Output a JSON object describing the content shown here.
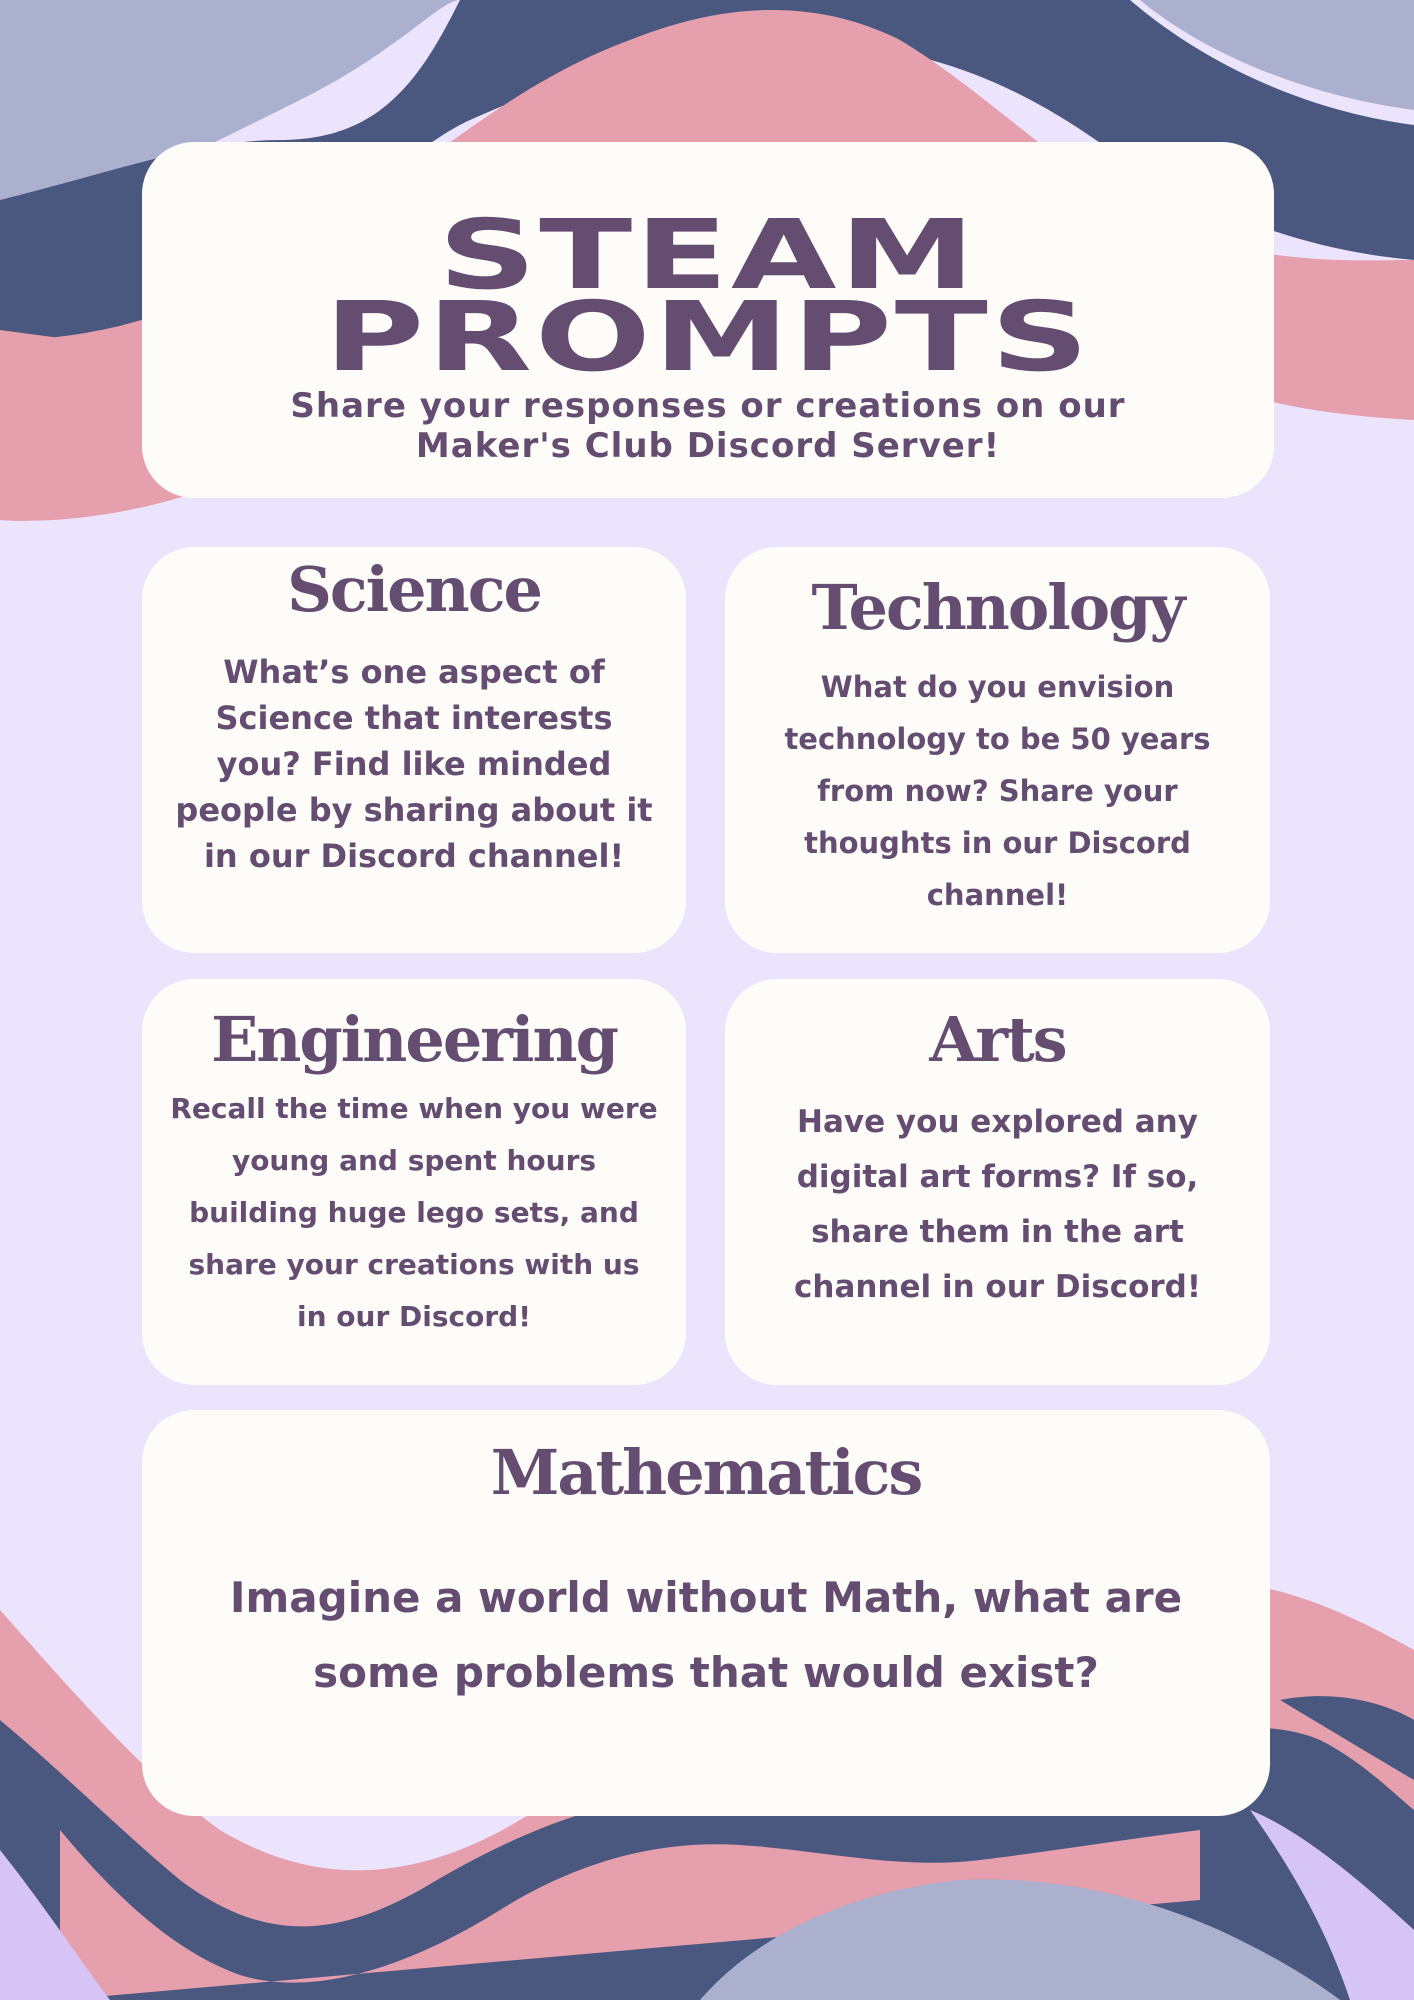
{
  "colors": {
    "background": "#ece3fd",
    "card": "#fdfcf8",
    "text": "#654d72",
    "wave_navy": "#4a5880",
    "wave_pink": "#e59fad",
    "wave_gray": "#aab0cd",
    "wave_lilac": "#d6c4f7"
  },
  "header": {
    "title_line1": "STEAM",
    "title_line2": "PROMPTS",
    "subtitle": "Share your responses or creations on our\nMaker's Club Discord Server!"
  },
  "cards": {
    "science": {
      "heading": "Science",
      "body": "What’s one aspect of Science that interests you? Find like minded people by sharing about it in our Discord channel!"
    },
    "technology": {
      "heading": "Technology",
      "body": "What do you envision technology to be 50 years from now? Share your thoughts in our Discord channel!"
    },
    "engineering": {
      "heading": "Engineering",
      "body": "Recall the time when you were young and spent hours building huge lego sets, and share your creations with us in our Discord!"
    },
    "arts": {
      "heading": "Arts",
      "body": "Have you explored any digital art forms? If so, share them in the art channel in our Discord!"
    },
    "mathematics": {
      "heading": "Mathematics",
      "body": "Imagine a world without Math, what are some problems that would exist?"
    }
  }
}
